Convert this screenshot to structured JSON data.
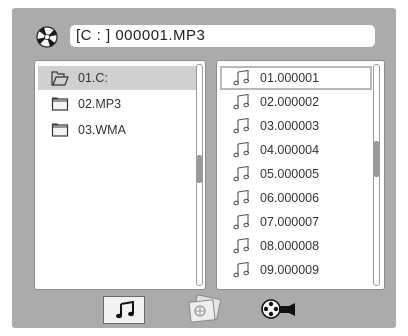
{
  "header": {
    "disc_icon": "disc-icon",
    "path_text": "[C : ]  000001.MP3"
  },
  "folders": [
    {
      "label": "01.C:",
      "icon": "open-folder-icon",
      "selected": true
    },
    {
      "label": "02.MP3",
      "icon": "folder-icon",
      "selected": false
    },
    {
      "label": "03.WMA",
      "icon": "folder-icon",
      "selected": false
    }
  ],
  "files": [
    {
      "label": "01.000001",
      "icon": "music-note-icon",
      "selected": true
    },
    {
      "label": "02.000002",
      "icon": "music-note-icon",
      "selected": false
    },
    {
      "label": "03.000003",
      "icon": "music-note-icon",
      "selected": false
    },
    {
      "label": "04.000004",
      "icon": "music-note-icon",
      "selected": false
    },
    {
      "label": "05.000005",
      "icon": "music-note-icon",
      "selected": false
    },
    {
      "label": "06.000006",
      "icon": "music-note-icon",
      "selected": false
    },
    {
      "label": "07.000007",
      "icon": "music-note-icon",
      "selected": false
    },
    {
      "label": "08.000008",
      "icon": "music-note-icon",
      "selected": false
    },
    {
      "label": "09.000009",
      "icon": "music-note-icon",
      "selected": false
    }
  ],
  "bottom_bar": {
    "modes": [
      {
        "name": "music",
        "icon": "music-note-icon",
        "active": true
      },
      {
        "name": "photo",
        "icon": "photo-icon",
        "active": false
      },
      {
        "name": "movie",
        "icon": "movie-camera-icon",
        "active": false
      }
    ]
  },
  "colors": {
    "background": "#ababab",
    "panel": "#ffffff",
    "selected_folder": "#d0d0d0"
  }
}
